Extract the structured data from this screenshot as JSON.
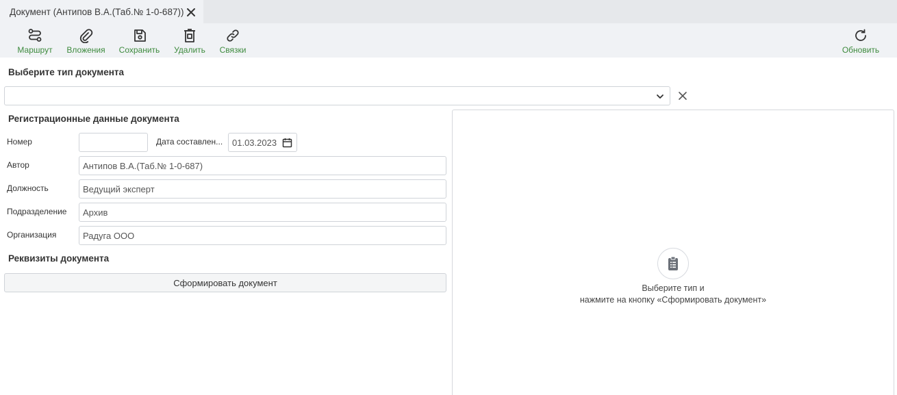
{
  "tab": {
    "title": "Документ (Антипов В.А.(Таб.№ 1-0-687))",
    "close_icon": "close-icon"
  },
  "toolbar": {
    "route_label": "Маршрут",
    "attachments_label": "Вложения",
    "save_label": "Сохранить",
    "delete_label": "Удалить",
    "links_label": "Связки",
    "refresh_label": "Обновить",
    "accent_color": "#3d8a3d"
  },
  "doc_type": {
    "title": "Выберите тип документа",
    "value": ""
  },
  "registration": {
    "title": "Регистрационные данные документа",
    "number_label": "Номер",
    "number_value": "",
    "date_label": "Дата составлен...",
    "date_value": "01.03.2023",
    "author_label": "Автор",
    "author_value": "Антипов В.А.(Таб.№ 1-0-687)",
    "position_label": "Должность",
    "position_value": "Ведущий эксперт",
    "department_label": "Подразделение",
    "department_value": "Архив",
    "organization_label": "Организация",
    "organization_value": "Радуга ООО"
  },
  "requisites": {
    "title": "Реквизиты документа",
    "generate_button": "Сформировать документ"
  },
  "preview": {
    "line1": "Выберите тип и",
    "line2": "нажмите на кнопку «Сформировать документ»"
  }
}
